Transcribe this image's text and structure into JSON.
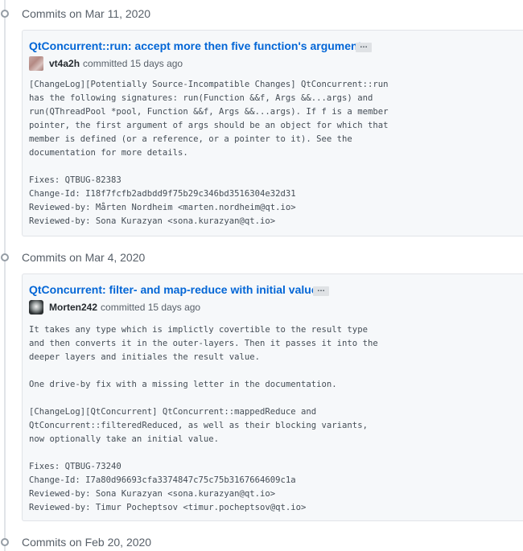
{
  "groups": [
    {
      "title": "Commits on Mar 11, 2020",
      "commit": {
        "title": "QtConcurrent::run: accept more then five function's arguments",
        "ellipsis": "…",
        "author": "vt4a2h",
        "meta": "committed 15 days ago",
        "message": "[ChangeLog][Potentially Source-Incompatible Changes] QtConcurrent::run\nhas the following signatures: run(Function &&f, Args &&...args) and\nrun(QThreadPool *pool, Function &&f, Args &&...args). If f is a member\npointer, the first argument of args should be an object for which that\nmember is defined (or a reference, or a pointer to it). See the\ndocumentation for more details.\n\nFixes: QTBUG-82383\nChange-Id: I18f7fcfb2adbdd9f75b29c346bd3516304e32d31\nReviewed-by: Mårten Nordheim <marten.nordheim@qt.io>\nReviewed-by: Sona Kurazyan <sona.kurazyan@qt.io>"
      }
    },
    {
      "title": "Commits on Mar 4, 2020",
      "commit": {
        "title": "QtConcurrent: filter- and map-reduce with initial value",
        "ellipsis": "…",
        "author": "Morten242",
        "meta": "committed 15 days ago",
        "message": "It takes any type which is implictly covertible to the result type\nand then converts it in the outer-layers. Then it passes it into the\ndeeper layers and initiales the result value.\n\nOne drive-by fix with a missing letter in the documentation.\n\n[ChangeLog][QtConcurrent] QtConcurrent::mappedReduce and\nQtConcurrent::filteredReduced, as well as their blocking variants,\nnow optionally take an initial value.\n\nFixes: QTBUG-73240\nChange-Id: I7a80d96693cfa3374847c75c75b3167664609c1a\nReviewed-by: Sona Kurazyan <sona.kurazyan@qt.io>\nReviewed-by: Timur Pocheptsov <timur.pocheptsov@qt.io>"
      }
    },
    {
      "title": "Commits on Feb 20, 2020"
    }
  ]
}
